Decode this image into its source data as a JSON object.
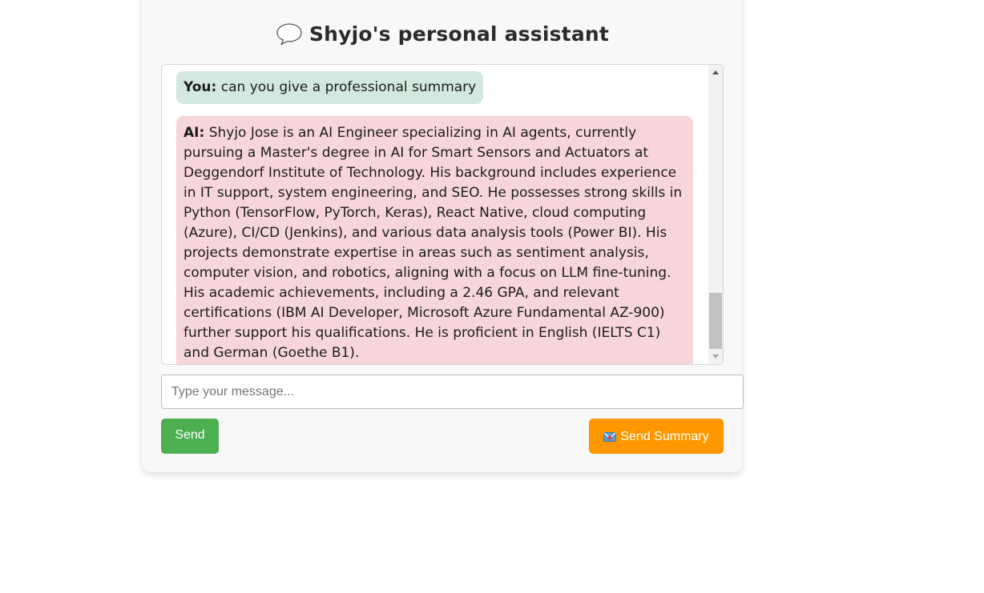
{
  "header": {
    "title": "Shyjo's personal assistant",
    "icon": "speech-bubble-icon"
  },
  "chat": {
    "messages": [
      {
        "speaker": "You:",
        "text": "can you give a professional summary",
        "role": "user",
        "color": "#d3e8de"
      },
      {
        "speaker": "AI:",
        "text": "Shyjo Jose is an AI Engineer specializing in AI agents, currently pursuing a Master's degree in AI for Smart Sensors and Actuators at Deggendorf Institute of Technology. His background includes experience in IT support, system engineering, and SEO. He possesses strong skills in Python (TensorFlow, PyTorch, Keras), React Native, cloud computing (Azure), CI/CD (Jenkins), and various data analysis tools (Power BI). His projects demonstrate expertise in areas such as sentiment analysis, computer vision, and robotics, aligning with a focus on LLM fine-tuning. His academic achievements, including a 2.46 GPA, and relevant certifications (IBM AI Developer, Microsoft Azure Fundamental AZ-900) further support his qualifications. He is proficient in English (IELTS C1) and German (Goethe B1).",
        "role": "ai",
        "color": "#f7d6db"
      }
    ]
  },
  "input": {
    "placeholder": "Type your message...",
    "value": ""
  },
  "buttons": {
    "send_label": "Send",
    "send_color": "#4caf50",
    "summary_label": "Send Summary",
    "summary_icon": "envelope-icon",
    "summary_color": "#ff9800"
  }
}
